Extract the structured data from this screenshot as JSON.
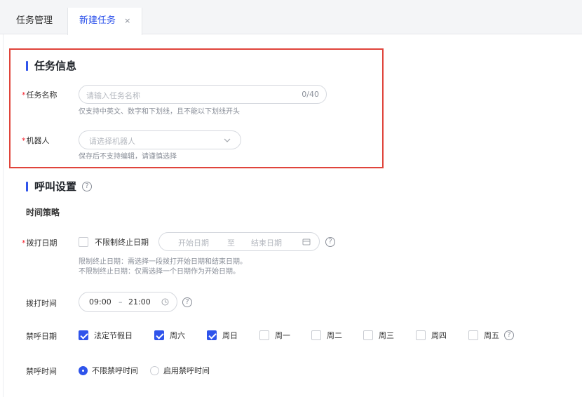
{
  "tabs": [
    {
      "label": "任务管理"
    },
    {
      "label": "新建任务",
      "close": "×"
    }
  ],
  "task_info": {
    "title": "任务信息",
    "name_label": "任务名称",
    "name_placeholder": "请输入任务名称",
    "name_counter": "0/40",
    "name_hint": "仅支持中英文、数字和下划线，且不能以下划线开头",
    "robot_label": "机器人",
    "robot_placeholder": "请选择机器人",
    "robot_hint": "保存后不支持编辑，请谨慎选择"
  },
  "call_settings": {
    "title": "呼叫设置",
    "time_strategy": "时间策略",
    "dial_date_label": "拨打日期",
    "unlimited_end_label": "不限制终止日期",
    "start_date_placeholder": "开始日期",
    "range_separator": "至",
    "end_date_placeholder": "结束日期",
    "date_hint_1": "限制终止日期：需选择一段拨打开始日期和结束日期。",
    "date_hint_2": "不限制终止日期：仅需选择一个日期作为开始日期。",
    "dial_time_label": "拨打时间",
    "time_start": "09:00",
    "time_dash": "–",
    "time_end": "21:00",
    "no_call_date_label": "禁呼日期",
    "days": [
      {
        "label": "法定节假日",
        "checked": true
      },
      {
        "label": "周六",
        "checked": true
      },
      {
        "label": "周日",
        "checked": true
      },
      {
        "label": "周一",
        "checked": false
      },
      {
        "label": "周二",
        "checked": false
      },
      {
        "label": "周三",
        "checked": false
      },
      {
        "label": "周四",
        "checked": false
      },
      {
        "label": "周五",
        "checked": false
      }
    ],
    "no_call_time_label": "禁呼时间",
    "radio_unlimited": "不限禁呼时间",
    "radio_enable": "启用禁呼时间",
    "radio_selected": "不限禁呼时间"
  },
  "accent_color": "#2f54eb",
  "highlight_color": "#e0443b"
}
